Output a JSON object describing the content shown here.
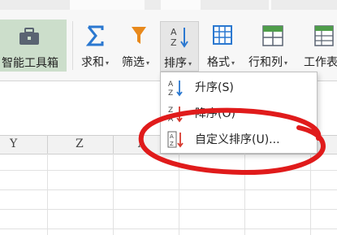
{
  "ribbon": {
    "toolbox_label": "智能工具箱",
    "buttons": [
      {
        "label": "求和",
        "icon": "sum-icon"
      },
      {
        "label": "筛选",
        "icon": "filter-icon"
      },
      {
        "label": "排序",
        "icon": "sort-icon"
      },
      {
        "label": "格式",
        "icon": "format-icon"
      },
      {
        "label": "行和列",
        "icon": "rows-columns-icon"
      },
      {
        "label": "工作表",
        "icon": "worksheet-icon"
      }
    ]
  },
  "sheet": {
    "columns": [
      "Y",
      "Z",
      "A"
    ]
  },
  "sort_menu": {
    "items": [
      {
        "label": "升序(S)",
        "icon": "sort-ascending-icon"
      },
      {
        "label": "降序(O)",
        "icon": "sort-descending-icon"
      },
      {
        "label": "自定义排序(U)...",
        "icon": "custom-sort-icon"
      }
    ]
  },
  "colors": {
    "toolbox_bg": "#ccdecb",
    "accent_blue": "#2b78d0",
    "filter_orange": "#e8891c",
    "annotation_red": "#e01b1b",
    "sort_red": "#d73a2f"
  }
}
